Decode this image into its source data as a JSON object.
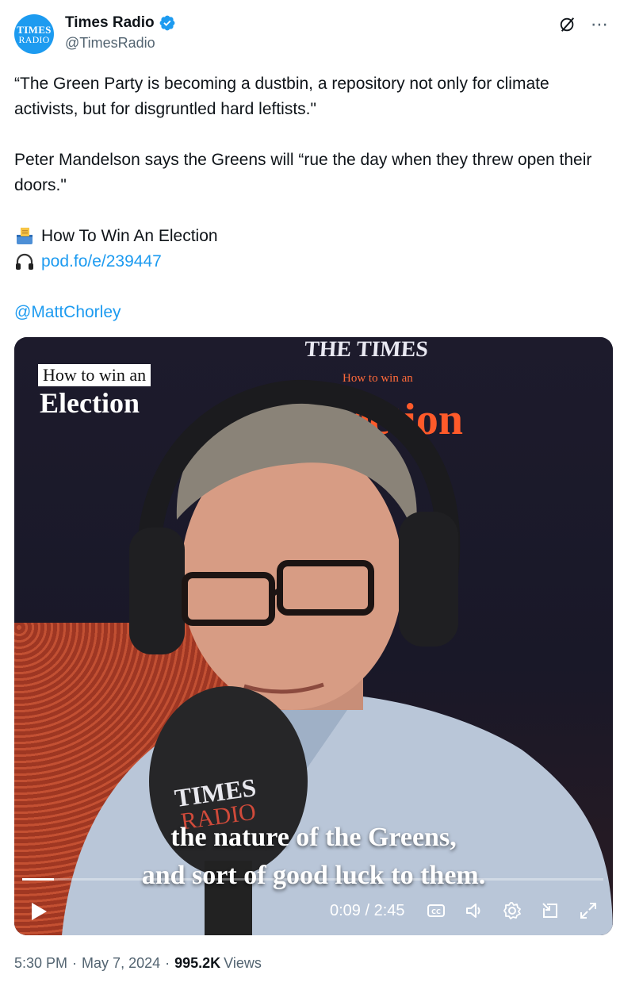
{
  "account": {
    "avatar_line1": "TIMES",
    "avatar_line2": "RADIO",
    "display_name": "Times Radio",
    "handle": "@TimesRadio"
  },
  "tweet": {
    "para1": "“The Green Party is becoming a dustbin, a repository not only for climate activists, but for disgruntled hard leftists.\"",
    "para2": "Peter Mandelson says the Greens will “rue the day when they threw open their doors.\"",
    "show_title": "How To Win An Election",
    "podcast_link": "pod.fo/e/239447",
    "mention": "@MattChorley"
  },
  "video": {
    "badge_small": "How to win an",
    "badge_big": "Election",
    "backdrop_logo": "THE TIMES",
    "backdrop_sub": "How to win an",
    "backdrop_big": "Election",
    "mic_text1": "TIMES",
    "mic_text2": "RADIO",
    "subtitle_line1": "the nature of the Greens,",
    "subtitle_line2": "and sort of good luck to them.",
    "time_display": "0:09 / 2:45",
    "progress_fraction": 0.055
  },
  "footer": {
    "time": "5:30 PM",
    "date": "May 7, 2024",
    "views_count": "995.2K",
    "views_label": "Views"
  },
  "icons": {
    "verified": "verified-badge-icon",
    "grok": "grok-icon",
    "more": "more-icon",
    "ballot": "ballot-box-icon",
    "headphones": "headphones-icon",
    "play": "play-icon",
    "captions": "captions-icon",
    "volume": "volume-icon",
    "settings": "settings-icon",
    "pip": "pip-icon",
    "fullscreen": "fullscreen-icon"
  },
  "colors": {
    "accent": "#1d9bf0",
    "text": "#0f1419",
    "muted": "#536471"
  }
}
